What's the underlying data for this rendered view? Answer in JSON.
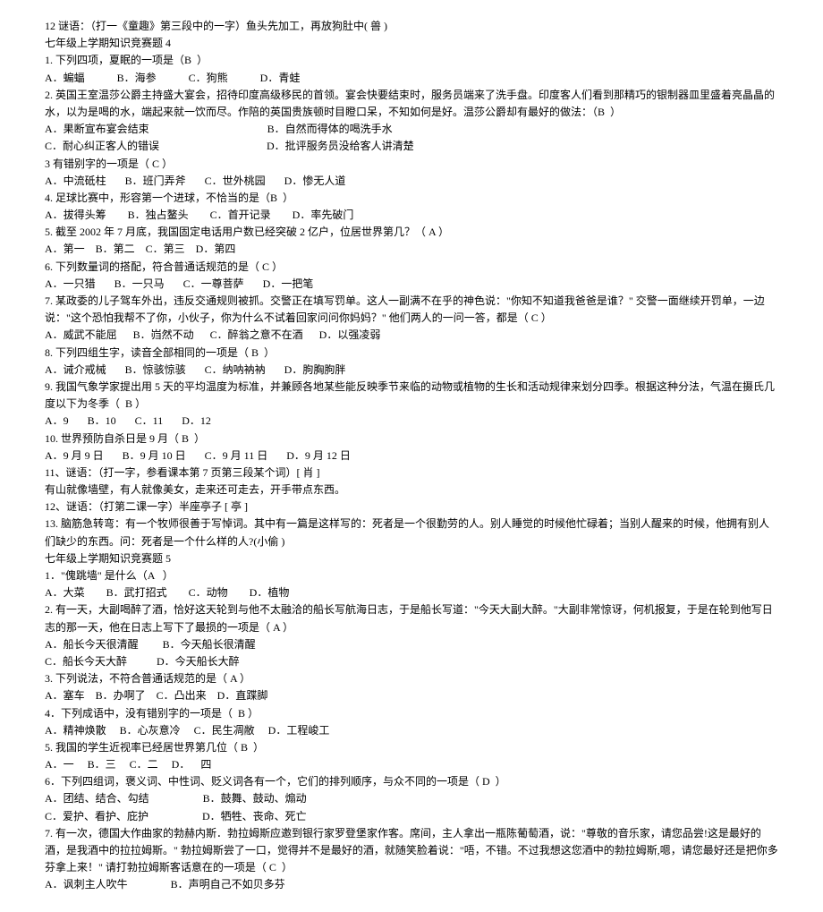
{
  "lines": [
    "12 谜语：（打一《童趣》第三段中的一字）鱼头先加工，再放狗肚中( 兽 )",
    "七年级上学期知识竞赛题 4",
    "1. 下列四项，夏眠的一项是（B  ）",
    "A．蝙蝠            B．海参            C．狗熊            D．青蛙",
    "2. 英国王室温莎公爵主持盛大宴会，招待印度高级移民的首领。宴会快要结束时，服务员端来了洗手盘。印度客人们看到那精巧的银制器皿里盛着亮晶晶的水，以为是喝的水，端起来就一饮而尽。作陪的英国贵族顿时目瞪口呆，不知如何是好。温莎公爵却有最好的做法：（B  ）",
    "A．果断宣布宴会结束                                            B．自然而得体的喝洗手水",
    "C．耐心纠正客人的错误                                        D．批评服务员没给客人讲清楚",
    "3 有错别字的一项是（ C ）",
    "A．中流砥柱       B．班门弄斧       C．世外桃园       D．惨无人道",
    "4. 足球比赛中，形容第一个进球，不恰当的是（B  ）",
    "A．拔得头筹        B．独占鳌头        C．首开记录        D．率先破门",
    "5. 截至 2002 年 7 月底，我国固定电话用户数已经突破 2 亿户，位居世界第几？（ A ）",
    "A．第一    B．第二    C．第三    D．第四",
    "6. 下列数量词的搭配，符合普通话规范的是（ C ）",
    "A．一只猎       B．一只马       C．一尊菩萨       D．一把笔",
    "7. 某政委的儿子驾车外出，违反交通规则被抓。交警正在填写罚单。这人一副满不在乎的神色说：\"你知不知道我爸爸是谁？\" 交警一面继续开罚单，一边说：\"这个恐怕我帮不了你，小伙子，你为什么不试着回家问问你妈妈？\" 他们两人的一问一答，都是（ C ）",
    "A．威武不能屈      B．岿然不动      C．醉翁之意不在酒      D．以强凌弱",
    "8. 下列四组生字，读音全部相同的一项是（ B  ）",
    "A．诫介戒械       B．惊骇惊骇       C．纳呐衲衲       D．朐胸朐胖",
    "9. 我国气象学家提出用 5 天的平均温度为标准，并兼顾各地某些能反映季节来临的动物或植物的生长和活动规律来划分四季。根据这种分法，气温在摄氏几度以下为冬季（  B ）",
    "A．9       B．10       C．11       D．12",
    "10. 世界预防自杀日是 9 月（ B  ）",
    "A．9 月 9 日       B．9 月 10 日       C．9 月 11 日       D．9 月 12 日",
    "11、谜语：（打一字，参看课本第 7 页第三段某个词）[ 肖 ]",
    "有山就像墙壁，有人就像美女，走来还可走去，开手带点东西。",
    "12、谜语：（打第二课一字）半座亭子 [ 亭 ]",
    "13. 脑筋急转弯：有一个牧师很善于写悼词。其中有一篇是这样写的：死者是一个很勤劳的人。别人睡觉的时候他忙碌着；当别人醒来的时候，他拥有别人们缺少的东西。问：死者是一个什么样的人?(小偷 )",
    "七年级上学期知识竞赛题 5",
    "1．\"傀跳墙\" 是什么（A   ）",
    "A．大菜        B．武打招式        C．动物        D．植物",
    "2. 有一天，大副喝醉了酒，恰好这天轮到与他不太融洽的船长写航海日志，于是船长写道：\"今天大副大醉。\"大副非常惊讶，何机报复，于是在轮到他写日志的那一天，他在日志上写下了最损的一项是（ A ）",
    "A．船长今天很清醒         B．今天船长很清醒",
    "C．船长今天大醉           D．今天船长大醉",
    "3. 下列说法，不符合普通话规范的是（ A ）",
    "A．塞车    B．办啊了    C．凸出来    D．直蹀脚",
    "4．下列成语中，没有错别字的一项是（  B ）",
    "A．精神焕散     B．心灰意冷     C．民生凋敝     D．工程峻工",
    "5. 我国的学生近视率已经居世界第几位（ B  ）",
    "A．一     B．三     C．二     D．    四",
    "6．下列四组词，褒义词、中性词、贬义词各有一个，它们的排列顺序，与众不同的一项是（ D  ）",
    "A．团结、结合、勾结                    B．鼓舞、鼓动、煽动",
    "C．爱护、看护、庇护                    D．牺牲、丧命、死亡",
    "7. 有一次，德国大作曲家的勃赫内斯．勃拉姆斯应邀到银行家罗登堡家作客。席间，主人拿出一瓶陈葡萄酒，说：\"尊敬的音乐家，请您品尝!这是最好的酒，是我酒中的拉拉姆斯。\" 勃拉姆斯尝了一口，觉得并不是最好的酒，就随笑脸着说：\"唔，不错。不过我想这您酒中的勃拉姆斯,嗯，请您最好还是把你多芬拿上来！\" 请打勃拉姆斯客话意在的一项是（ C  ）",
    "A．讽刺主人吹牛                B．声明自己不如贝多芬"
  ]
}
